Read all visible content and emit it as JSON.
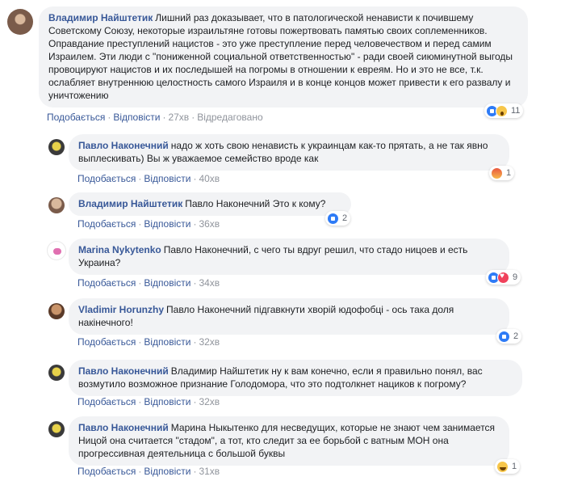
{
  "actions": {
    "like": "Подобається",
    "reply": "Відповісти",
    "edited": "Відредаговано"
  },
  "comments": [
    {
      "author": "Владимир Найштетик",
      "text": "Лишний раз доказывает, что в патологической ненависти к почившему Советскому Союзу, некоторые израильтяне готовы пожертвовать памятью своих соплеменников. Оправдание преступлений нацистов - это уже преступление перед человечеством и перед самим Израилем. Эти люди с \"пониженной социальной ответственностью\" - ради своей сиюминутной выгоды провоцируют нацистов и их последышей на погромы в отношении к евреям. Но и это не все, т.к. ослабляет внутреннюю целостность самого Израиля и в конце концов может привести к его развалу и уничтожению",
      "time": "27хв",
      "reactions": {
        "icons": [
          "like-icon",
          "wow-icon"
        ],
        "count": "11"
      }
    },
    {
      "author": "Павло Наконечний",
      "text": "надо ж хоть свою ненависть к украинцам как-то прятать, а не так явно выплескивать) Вы ж уважаемое семейство вроде как",
      "time": "40хв",
      "reactions": {
        "icons": [
          "angry-icon"
        ],
        "count": "1"
      }
    },
    {
      "author": "Владимир Найштетик",
      "text": "Павло Наконечний Это к кому?",
      "time": "36хв",
      "reactions": {
        "icons": [
          "like-icon"
        ],
        "count": "2"
      }
    },
    {
      "author": "Marina Nykytenko",
      "text": "Павло Наконечний, с чего ты вдруг решил, что стадо ницоев и есть Украина?",
      "time": "34хв",
      "reactions": {
        "icons": [
          "like-icon",
          "love-icon"
        ],
        "count": "9"
      }
    },
    {
      "author": "Vladimir Horunzhy",
      "text": "Павло Наконечний підгавкнути хворій юдофобці - ось така доля накінечного!",
      "time": "32хв",
      "reactions": {
        "icons": [
          "like-icon"
        ],
        "count": "2"
      }
    },
    {
      "author": "Павло Наконечний",
      "text": "Владимир Найштетик ну к вам конечно, если я правильно понял, вас возмутило возможное признание Голодомора, что это подтолкнет нациков к погрому?",
      "time": "32хв",
      "reactions": null
    },
    {
      "author": "Павло Наконечний",
      "text": "Марина Ныкытенко для несведущих, которые не знают чем занимается Ницой она считается \"стадом\", а тот, кто следит за ее борьбой с ватным МОН она прогрессивная деятельница с большой буквы",
      "time": "31хв",
      "reactions": {
        "icons": [
          "haha-icon"
        ],
        "count": "1"
      }
    }
  ]
}
